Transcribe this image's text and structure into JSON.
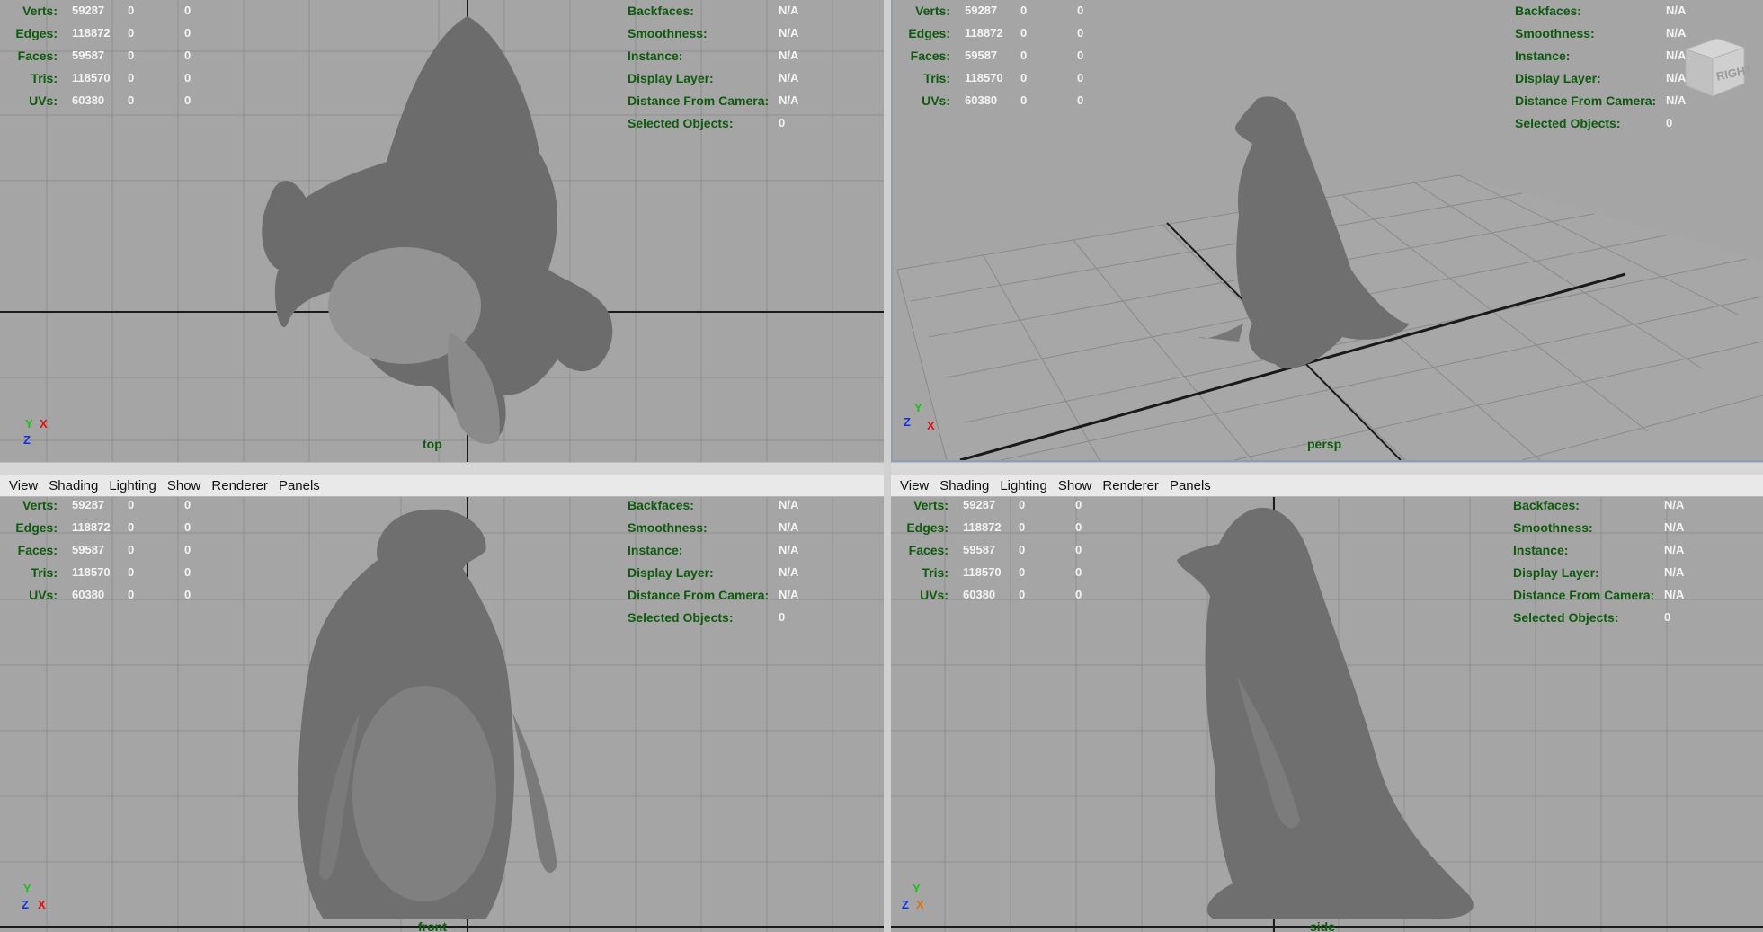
{
  "menu": [
    "View",
    "Shading",
    "Lighting",
    "Show",
    "Renderer",
    "Panels"
  ],
  "hud_left": [
    {
      "label": "Verts:",
      "v1": "59287",
      "v2": "0",
      "v3": "0"
    },
    {
      "label": "Edges:",
      "v1": "118872",
      "v2": "0",
      "v3": "0"
    },
    {
      "label": "Faces:",
      "v1": "59587",
      "v2": "0",
      "v3": "0"
    },
    {
      "label": "Tris:",
      "v1": "118570",
      "v2": "0",
      "v3": "0"
    },
    {
      "label": "UVs:",
      "v1": "60380",
      "v2": "0",
      "v3": "0"
    }
  ],
  "hud_right": [
    {
      "label": "Backfaces:",
      "value": "N/A"
    },
    {
      "label": "Smoothness:",
      "value": "N/A"
    },
    {
      "label": "Instance:",
      "value": "N/A"
    },
    {
      "label": "Display Layer:",
      "value": "N/A"
    },
    {
      "label": "Distance From Camera:",
      "value": "N/A"
    },
    {
      "label": "Selected Objects:",
      "value": "0"
    }
  ],
  "viewports": {
    "top": {
      "camera": "top",
      "axes": [
        "Y",
        "X",
        "Z"
      ]
    },
    "persp": {
      "camera": "persp",
      "axes": [
        "Y",
        "Z",
        "X"
      ],
      "viewcube": "RIGHT"
    },
    "front": {
      "camera": "front",
      "axes": [
        "Y",
        "Z",
        "X"
      ]
    },
    "side": {
      "camera": "side",
      "axes": [
        "Y",
        "Z",
        "X"
      ]
    }
  },
  "colors": {
    "viewport_bg": "#a5a5a5",
    "hud_label": "#0f5a0f",
    "hud_value": "#f4f4f4",
    "grid": "#8c8c8c",
    "grid_axis": "#1a1a1a"
  }
}
